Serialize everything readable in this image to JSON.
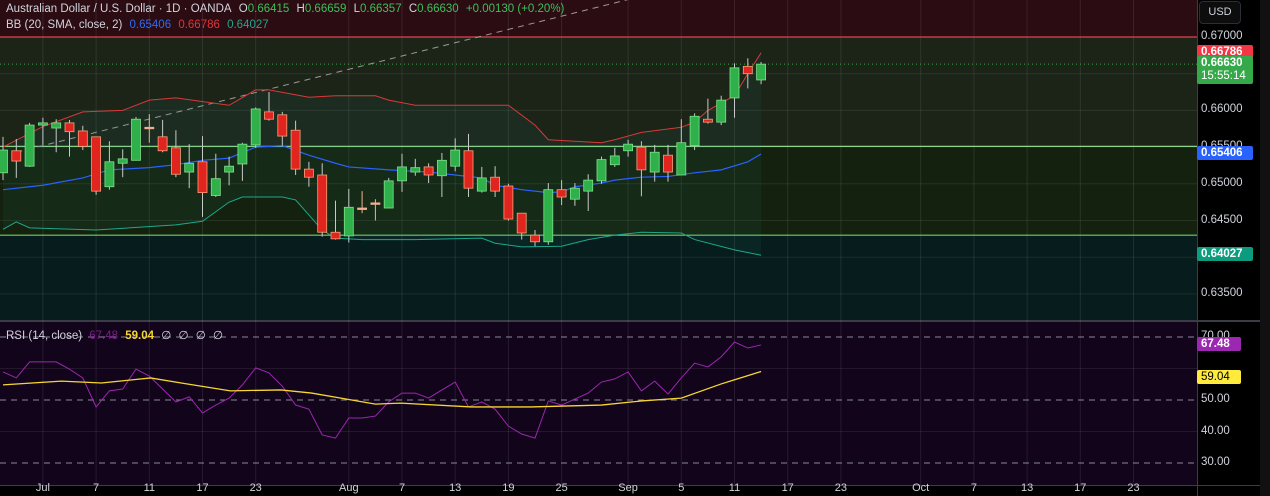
{
  "header": {
    "symbol": "Australian Dollar / U.S. Dollar · 1D · OANDA",
    "o_label": "O",
    "o": "0.66415",
    "h_label": "H",
    "h": "0.66659",
    "l_label": "L",
    "l": "0.66357",
    "c_label": "C",
    "c": "0.66630",
    "change": "+0.00130 (+0.20%)"
  },
  "bb_legend": {
    "label": "BB (20, SMA, close, 2)",
    "basis": "0.65406",
    "upper": "0.66786",
    "lower": "0.64027"
  },
  "rsi_legend": {
    "label": "RSI (14, close)",
    "rsi": "67.48",
    "ma": "59.04",
    "na": [
      "∅",
      "∅",
      "∅",
      "∅"
    ]
  },
  "currency_button": "USD",
  "price_axis": {
    "labels": [
      {
        "v": 0.67,
        "t": "0.67000"
      },
      {
        "v": 0.66,
        "t": "0.66000"
      },
      {
        "v": 0.655,
        "t": "0.65500"
      },
      {
        "v": 0.65,
        "t": "0.65000"
      },
      {
        "v": 0.645,
        "t": "0.64500"
      },
      {
        "v": 0.635,
        "t": "0.63500"
      }
    ],
    "tags": {
      "upper": "0.66786",
      "last": "0.66630",
      "countdown": "15:55:14",
      "basis": "0.65406",
      "lower": "0.64027"
    }
  },
  "rsi_axis": {
    "labels": [
      {
        "v": 70,
        "t": "70.00"
      },
      {
        "v": 50,
        "t": "50.00"
      },
      {
        "v": 40,
        "t": "40.00"
      },
      {
        "v": 30,
        "t": "30.00"
      }
    ],
    "tags": {
      "rsi": "67.48",
      "ma": "59.04"
    }
  },
  "time_axis": [
    {
      "i": 3,
      "t": "Jul"
    },
    {
      "i": 7,
      "t": "7"
    },
    {
      "i": 11,
      "t": "11"
    },
    {
      "i": 15,
      "t": "17"
    },
    {
      "i": 19,
      "t": "23"
    },
    {
      "i": 26,
      "t": "Aug"
    },
    {
      "i": 30,
      "t": "7"
    },
    {
      "i": 34,
      "t": "13"
    },
    {
      "i": 38,
      "t": "19"
    },
    {
      "i": 42,
      "t": "25"
    },
    {
      "i": 47,
      "t": "Sep"
    },
    {
      "i": 51,
      "t": "5"
    },
    {
      "i": 55,
      "t": "11"
    },
    {
      "i": 59,
      "t": "17"
    },
    {
      "i": 63,
      "t": "23"
    },
    {
      "i": 69,
      "t": "Oct"
    },
    {
      "i": 73,
      "t": "7"
    },
    {
      "i": 77,
      "t": "13"
    },
    {
      "i": 81,
      "t": "17"
    },
    {
      "i": 85,
      "t": "23"
    }
  ],
  "colors": {
    "up": "#2fb04a",
    "down": "#e0251f",
    "basis": "#2962ff",
    "upper": "#d83a3a",
    "lower": "#1ba98c",
    "rsi": "#9c27b0",
    "rsi_ma": "#f5d730",
    "tag_last": "#35a849"
  },
  "chart_data": {
    "type": "candlestick",
    "title": "Australian Dollar / U.S. Dollar · 1D · OANDA",
    "ohlc": [
      [
        0.6515,
        0.6564,
        0.6505,
        0.6546
      ],
      [
        0.6545,
        0.6561,
        0.6508,
        0.6531
      ],
      [
        0.6524,
        0.6583,
        0.6523,
        0.658
      ],
      [
        0.658,
        0.659,
        0.6553,
        0.6583
      ],
      [
        0.6576,
        0.6588,
        0.6543,
        0.6583
      ],
      [
        0.6583,
        0.6587,
        0.6537,
        0.6571
      ],
      [
        0.6572,
        0.6579,
        0.6546,
        0.6551
      ],
      [
        0.6564,
        0.6564,
        0.6485,
        0.649
      ],
      [
        0.6496,
        0.6558,
        0.6492,
        0.653
      ],
      [
        0.6528,
        0.6547,
        0.6509,
        0.6534
      ],
      [
        0.6532,
        0.6591,
        0.6532,
        0.6588
      ],
      [
        0.6576,
        0.6595,
        0.6556,
        0.6577
      ],
      [
        0.6564,
        0.6587,
        0.6543,
        0.6545
      ],
      [
        0.6549,
        0.6573,
        0.6509,
        0.6513
      ],
      [
        0.6516,
        0.6554,
        0.6494,
        0.6528
      ],
      [
        0.653,
        0.6565,
        0.6455,
        0.6488
      ],
      [
        0.6484,
        0.6541,
        0.6482,
        0.6507
      ],
      [
        0.6516,
        0.6537,
        0.6498,
        0.6524
      ],
      [
        0.6527,
        0.6556,
        0.6504,
        0.6554
      ],
      [
        0.6553,
        0.6604,
        0.6549,
        0.6602
      ],
      [
        0.6598,
        0.6625,
        0.6586,
        0.6588
      ],
      [
        0.6594,
        0.6598,
        0.6552,
        0.6565
      ],
      [
        0.6573,
        0.6586,
        0.6512,
        0.652
      ],
      [
        0.652,
        0.653,
        0.6496,
        0.6509
      ],
      [
        0.6512,
        0.6528,
        0.6428,
        0.6434
      ],
      [
        0.6434,
        0.6477,
        0.6424,
        0.6425
      ],
      [
        0.6429,
        0.6493,
        0.642,
        0.6468
      ],
      [
        0.6467,
        0.649,
        0.646,
        0.6466
      ],
      [
        0.6473,
        0.6479,
        0.645,
        0.6474
      ],
      [
        0.6467,
        0.6508,
        0.6467,
        0.6504
      ],
      [
        0.6504,
        0.6541,
        0.6489,
        0.6523
      ],
      [
        0.6516,
        0.6534,
        0.6511,
        0.6522
      ],
      [
        0.6523,
        0.6528,
        0.6501,
        0.6512
      ],
      [
        0.6511,
        0.6542,
        0.6482,
        0.6532
      ],
      [
        0.6524,
        0.6562,
        0.6517,
        0.6546
      ],
      [
        0.6545,
        0.6568,
        0.6482,
        0.6494
      ],
      [
        0.649,
        0.6523,
        0.6488,
        0.6508
      ],
      [
        0.6509,
        0.6524,
        0.6482,
        0.649
      ],
      [
        0.6497,
        0.65,
        0.645,
        0.6452
      ],
      [
        0.646,
        0.646,
        0.6424,
        0.6433
      ],
      [
        0.643,
        0.6437,
        0.6415,
        0.6421
      ],
      [
        0.6421,
        0.6501,
        0.6417,
        0.6492
      ],
      [
        0.6492,
        0.6505,
        0.6471,
        0.6482
      ],
      [
        0.6479,
        0.6501,
        0.647,
        0.6494
      ],
      [
        0.649,
        0.6513,
        0.6463,
        0.6505
      ],
      [
        0.6504,
        0.6537,
        0.65,
        0.6533
      ],
      [
        0.6526,
        0.6549,
        0.6523,
        0.6538
      ],
      [
        0.6545,
        0.656,
        0.6537,
        0.6554
      ],
      [
        0.655,
        0.6558,
        0.6483,
        0.6519
      ],
      [
        0.6516,
        0.6553,
        0.6503,
        0.6543
      ],
      [
        0.6539,
        0.6553,
        0.6503,
        0.6516
      ],
      [
        0.6512,
        0.6588,
        0.6512,
        0.6556
      ],
      [
        0.6552,
        0.6596,
        0.6546,
        0.6592
      ],
      [
        0.6588,
        0.6616,
        0.6582,
        0.6584
      ],
      [
        0.6584,
        0.662,
        0.658,
        0.6614
      ],
      [
        0.6617,
        0.6664,
        0.659,
        0.6658
      ],
      [
        0.666,
        0.6671,
        0.663,
        0.665
      ],
      [
        0.66415,
        0.66659,
        0.66357,
        0.6663
      ]
    ],
    "bb_upper": [
      [
        0,
        0.655
      ],
      [
        3,
        0.6578
      ],
      [
        6,
        0.6598
      ],
      [
        9,
        0.66
      ],
      [
        11,
        0.6614
      ],
      [
        13,
        0.6617
      ],
      [
        17,
        0.6607
      ],
      [
        19,
        0.6628
      ],
      [
        20,
        0.6628
      ],
      [
        23,
        0.6618
      ],
      [
        25,
        0.662
      ],
      [
        28,
        0.662
      ],
      [
        29,
        0.6614
      ],
      [
        31,
        0.6607
      ],
      [
        38,
        0.6607
      ],
      [
        40,
        0.658
      ],
      [
        41,
        0.656
      ],
      [
        45,
        0.6556
      ],
      [
        46,
        0.656
      ],
      [
        48,
        0.657
      ],
      [
        51,
        0.6577
      ],
      [
        52,
        0.6584
      ],
      [
        53,
        0.66
      ],
      [
        55,
        0.662
      ],
      [
        56,
        0.665
      ],
      [
        57,
        0.66786
      ]
    ],
    "bb_basis": [
      [
        0,
        0.6492
      ],
      [
        3,
        0.6498
      ],
      [
        6,
        0.6508
      ],
      [
        8,
        0.6519
      ],
      [
        11,
        0.6522
      ],
      [
        13,
        0.6526
      ],
      [
        15,
        0.6532
      ],
      [
        17,
        0.6535
      ],
      [
        19,
        0.655
      ],
      [
        21,
        0.6552
      ],
      [
        23,
        0.6539
      ],
      [
        25,
        0.6528
      ],
      [
        26,
        0.6523
      ],
      [
        29,
        0.6519
      ],
      [
        32,
        0.6516
      ],
      [
        34,
        0.6512
      ],
      [
        36,
        0.6508
      ],
      [
        37,
        0.6498
      ],
      [
        39,
        0.6492
      ],
      [
        41,
        0.6488
      ],
      [
        42,
        0.6489
      ],
      [
        43,
        0.6496
      ],
      [
        45,
        0.6501
      ],
      [
        46,
        0.6505
      ],
      [
        48,
        0.6509
      ],
      [
        50,
        0.651
      ],
      [
        52,
        0.6515
      ],
      [
        54,
        0.6519
      ],
      [
        56,
        0.653
      ],
      [
        57,
        0.65406
      ]
    ],
    "bb_lower": [
      [
        0,
        0.6438
      ],
      [
        1,
        0.6448
      ],
      [
        2,
        0.644
      ],
      [
        7,
        0.6437
      ],
      [
        13,
        0.6444
      ],
      [
        15,
        0.6449
      ],
      [
        17,
        0.6475
      ],
      [
        18,
        0.6482
      ],
      [
        21,
        0.6482
      ],
      [
        22,
        0.6478
      ],
      [
        24,
        0.6437
      ],
      [
        25,
        0.6426
      ],
      [
        27,
        0.6424
      ],
      [
        31,
        0.6424
      ],
      [
        36,
        0.6426
      ],
      [
        37,
        0.6419
      ],
      [
        39,
        0.6414
      ],
      [
        42,
        0.6415
      ],
      [
        44,
        0.6424
      ],
      [
        46,
        0.643
      ],
      [
        48,
        0.6434
      ],
      [
        51,
        0.6433
      ],
      [
        52,
        0.6424
      ],
      [
        55,
        0.641
      ],
      [
        57,
        0.64027
      ]
    ],
    "hlines": {
      "resistance": 0.67,
      "mid": 0.6551,
      "support": 0.643,
      "last": 0.6663
    },
    "trendline": [
      [
        1,
        0.6543
      ],
      [
        47,
        0.6751
      ]
    ],
    "rsi": [
      58.9,
      57.0,
      62.1,
      62.1,
      62.1,
      59.8,
      57.0,
      47.8,
      52.9,
      53.5,
      59.8,
      57.6,
      53.5,
      49.4,
      51.0,
      45.9,
      48.4,
      50.6,
      54.8,
      60.2,
      58.6,
      54.4,
      48.4,
      47.1,
      38.9,
      37.9,
      44.3,
      44.3,
      44.9,
      49.4,
      52.2,
      52.2,
      50.6,
      53.2,
      55.7,
      47.8,
      49.4,
      47.1,
      41.7,
      39.2,
      37.9,
      49.7,
      48.4,
      50.3,
      52.2,
      55.7,
      56.7,
      58.9,
      52.9,
      56.0,
      51.9,
      57.0,
      61.7,
      60.5,
      63.7,
      68.4,
      66.5,
      67.48
    ],
    "rsi_ma": [
      [
        0,
        54.8
      ],
      [
        4.4,
        56.0
      ],
      [
        7.4,
        55.4
      ],
      [
        11.1,
        57.0
      ],
      [
        13.4,
        55.4
      ],
      [
        17.1,
        52.9
      ],
      [
        20.9,
        53.2
      ],
      [
        23.2,
        52.2
      ],
      [
        25.4,
        50.6
      ],
      [
        28,
        48.7
      ],
      [
        29.9,
        49.0
      ],
      [
        35.2,
        47.8
      ],
      [
        39.7,
        47.8
      ],
      [
        45,
        48.4
      ],
      [
        48,
        49.7
      ],
      [
        51,
        50.6
      ],
      [
        54,
        55.1
      ],
      [
        57,
        59.04
      ]
    ],
    "price_range": [
      0.6325,
      0.675
    ],
    "rsi_range": [
      25,
      75
    ],
    "rsi_bands": [
      70,
      50,
      30
    ]
  }
}
